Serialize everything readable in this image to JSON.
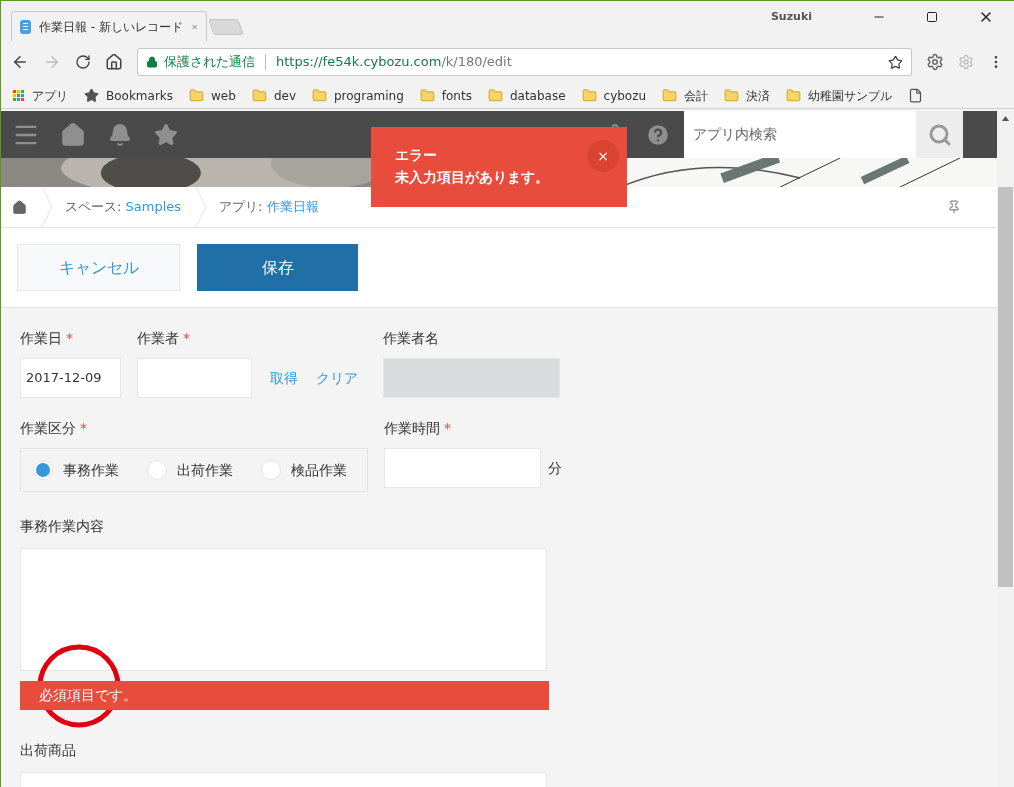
{
  "browser": {
    "tab": {
      "title": "作業日報 - 新しいレコード"
    },
    "user": "Suzuki",
    "address": {
      "secure_label": "保護された通信",
      "url_main": "https://fe54k.cybozu.com",
      "url_path": "/k/180/edit"
    },
    "bookmarks": [
      {
        "kind": "apps",
        "label": "アプリ"
      },
      {
        "kind": "star",
        "label": "Bookmarks"
      },
      {
        "kind": "folder",
        "label": "web"
      },
      {
        "kind": "folder",
        "label": "dev"
      },
      {
        "kind": "folder",
        "label": "programing"
      },
      {
        "kind": "folder",
        "label": "fonts"
      },
      {
        "kind": "folder",
        "label": "database"
      },
      {
        "kind": "folder",
        "label": "cybozu"
      },
      {
        "kind": "folder",
        "label": "会計"
      },
      {
        "kind": "folder",
        "label": "決済"
      },
      {
        "kind": "folder",
        "label": "幼稚園サンプル"
      },
      {
        "kind": "page"
      }
    ]
  },
  "header": {
    "search": {
      "placeholder": "アプリ内検索"
    }
  },
  "toast": {
    "title": "エラー",
    "message": "未入力項目があります。",
    "close": "×"
  },
  "breadcrumb": [
    {
      "prefix": "スペース: ",
      "link": "Samples"
    },
    {
      "prefix": "アプリ: ",
      "link": "作業日報"
    }
  ],
  "actions": {
    "cancel": "キャンセル",
    "save": "保存"
  },
  "form": {
    "work_date": {
      "label": "作業日",
      "mark": "*",
      "value": "2017-12-09"
    },
    "worker": {
      "label": "作業者",
      "mark": "*",
      "links": [
        "取得",
        "クリア"
      ]
    },
    "worker_name": {
      "label": "作業者名",
      "disabled": true
    },
    "category": {
      "label": "作業区分",
      "mark": "*",
      "options": [
        {
          "label": "事務作業",
          "selected": true
        },
        {
          "label": "出荷作業",
          "selected": false
        },
        {
          "label": "検品作業",
          "selected": false
        }
      ]
    },
    "work_time": {
      "label": "作業時間",
      "mark": "*",
      "unit": "分"
    },
    "details": {
      "label": "事務作業内容",
      "error": "必須項目です。"
    },
    "shipment": {
      "label": "出荷商品"
    }
  }
}
